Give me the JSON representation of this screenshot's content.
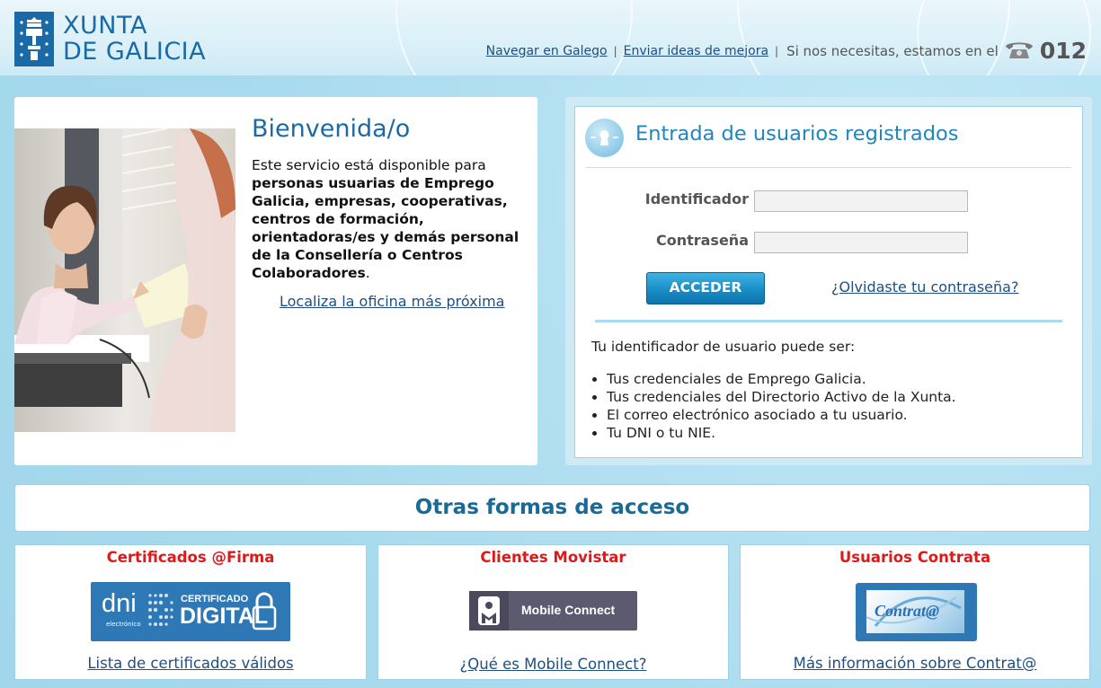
{
  "header": {
    "logo_line1": "XUNTA",
    "logo_line2": "DE GALICIA",
    "link_galego": "Navegar en Galego",
    "link_ideas": "Enviar ideas de mejora",
    "separator": "|",
    "help_text": "Si nos necesitas, estamos en el",
    "phone_number": "012"
  },
  "welcome": {
    "title": "Bienvenida/o",
    "intro": "Este servicio está disponible para",
    "audience": "personas usuarias de Emprego Galicia, empresas, cooperativas, centros de formación, orientadoras/es y demás personal de la Consellería o Centros Colaboradores",
    "period": ".",
    "office_link": "Localiza la oficina más próxima"
  },
  "login": {
    "title": "Entrada de usuarios registrados",
    "id_label": "Identificador",
    "id_value": "",
    "password_label": "Contraseña",
    "password_value": "",
    "submit_label": "ACCEDER",
    "forgot_link": "¿Olvidaste tu contraseña?",
    "hint": "Tu identificador de usuario puede ser:",
    "options": [
      "Tus credenciales de Emprego Galicia.",
      "Tus credenciales del Directorio Activo de la Xunta.",
      "El correo electrónico asociado a tu usuario.",
      "Tu DNI o tu NIE."
    ]
  },
  "other_access": {
    "title": "Otras formas de acceso",
    "cards": [
      {
        "title": "Certificados @Firma",
        "badge_small": "dni",
        "badge_sub": "electrónico",
        "badge_top": "CERTIFICADO",
        "badge_main": "DIGITAL",
        "link": "Lista de certificados válidos"
      },
      {
        "title": "Clientes Movistar",
        "badge_label": "Mobile Connect",
        "link": "¿Qué es Mobile Connect?"
      },
      {
        "title": "Usuarios Contrata",
        "badge_label": "Contrat@",
        "link": "Más información sobre Contrat@"
      }
    ]
  },
  "colors": {
    "brand_blue": "#1b6aa8",
    "accent_red": "#dd1a1a",
    "link_blue": "#1f4f80",
    "button_blue": "#1a8cc6"
  },
  "icons": [
    "xunta-shield-icon",
    "phone-icon",
    "keyhole-icon",
    "dni-certificate-icon",
    "mobile-connect-icon",
    "contrata-icon"
  ]
}
